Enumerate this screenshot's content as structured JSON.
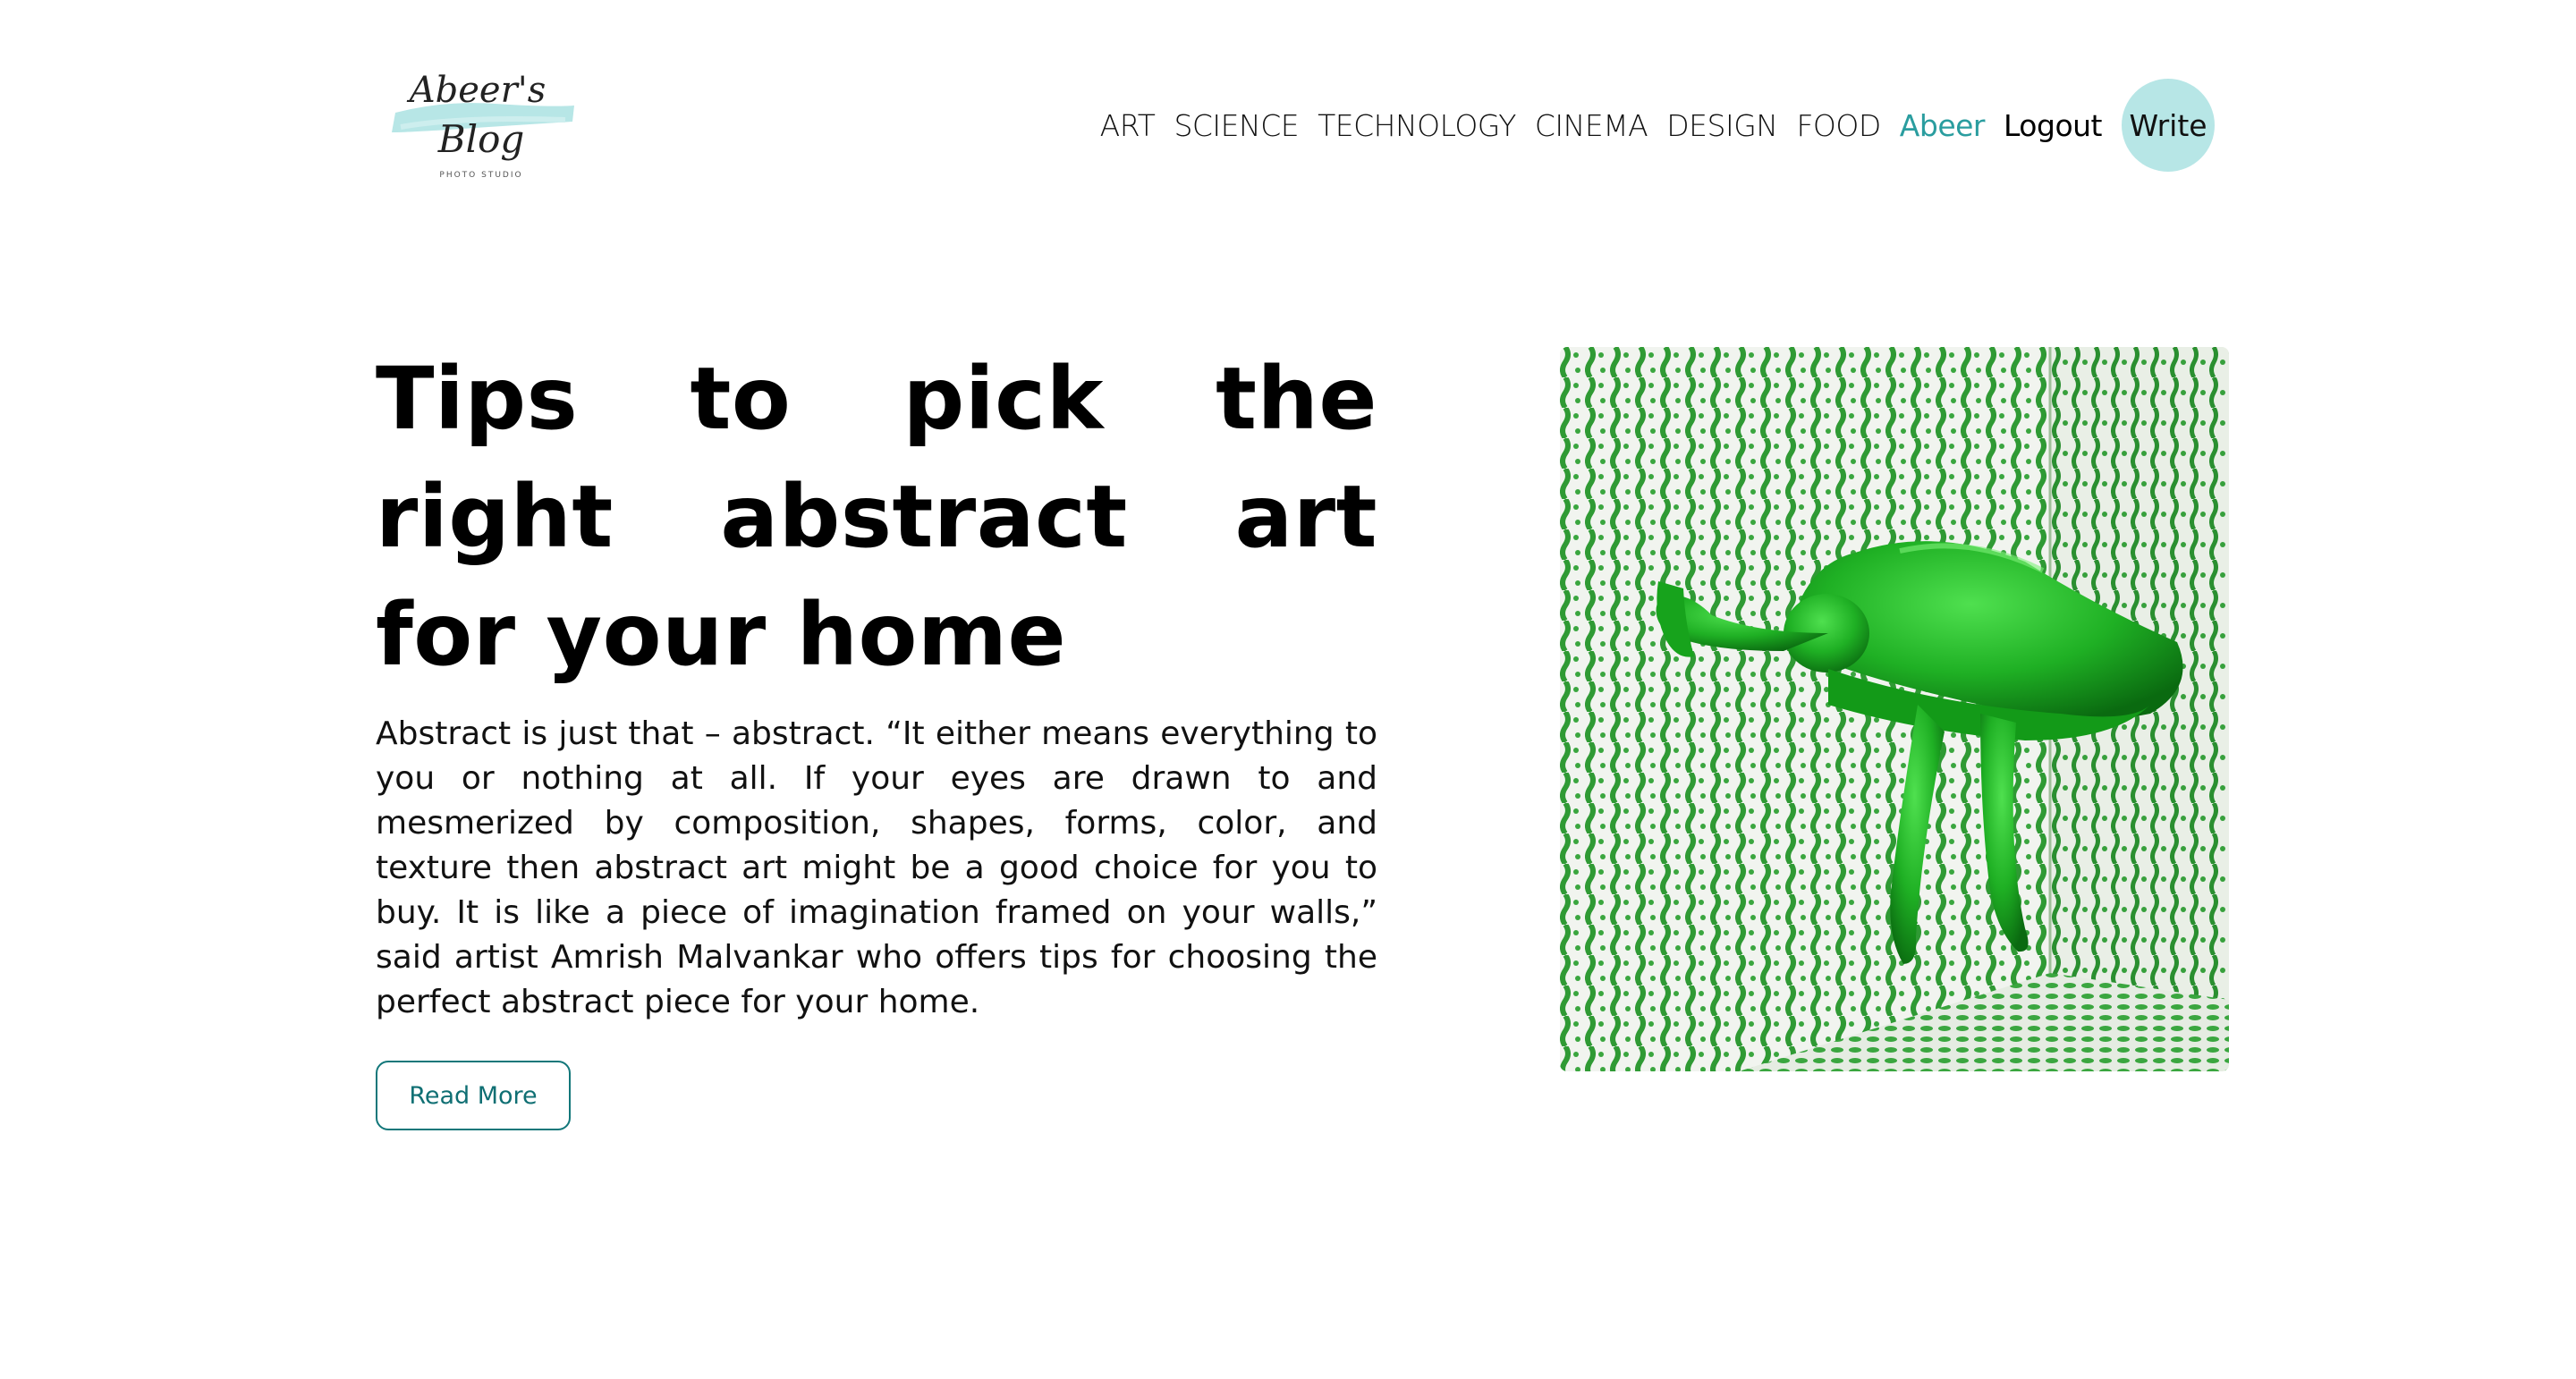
{
  "logo": {
    "line1": "Abeer's",
    "line2": "Blog",
    "tagline": "PHOTO STUDIO",
    "accent": "#b7e6e6"
  },
  "nav": {
    "items": [
      "ART",
      "SCIENCE",
      "TECHNOLOGY",
      "CINEMA",
      "DESIGN",
      "FOOD"
    ],
    "user": "Abeer",
    "logout": "Logout",
    "write": "Write"
  },
  "post": {
    "title": "Tips to pick the right abstract art for your home",
    "excerpt": "Abstract is just that – abstract. “It either means everything to you or nothing at all. If your eyes are drawn to and mesmerized by composition, shapes, forms, color, and texture then abstract art might be a good choice for you to buy. It is like a piece of imagination framed on your walls,” said artist Amrish Malvankar who offers tips for choosing the perfect abstract piece for your home.",
    "read_more": "Read More",
    "image_subject": "green-figure-sculpture"
  },
  "colors": {
    "accent": "#2a9d9f",
    "button_border": "#12777a",
    "write_bg": "#b7e6e6",
    "art_green": "#1f8a2a"
  }
}
